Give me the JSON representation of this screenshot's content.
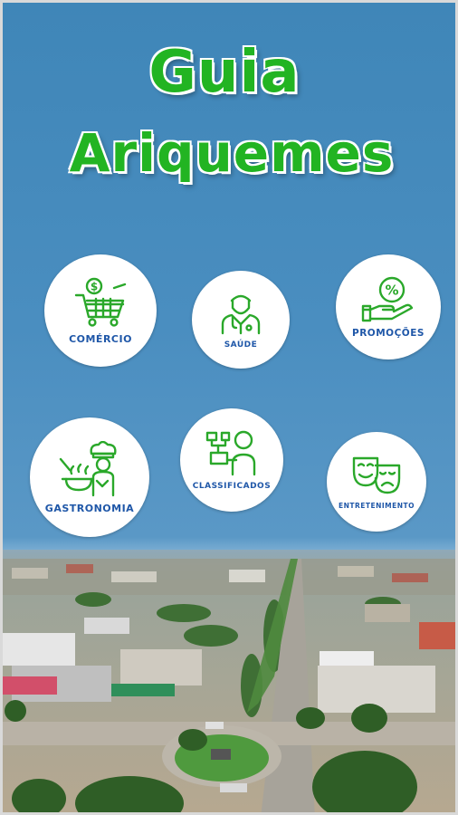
{
  "app": {
    "title_line1": "Guia",
    "title_line2": "Ariquemes"
  },
  "colors": {
    "brand_green": "#22b422",
    "label_blue": "#1f57a8",
    "sky_blue": "#4a8ec0"
  },
  "categories": [
    {
      "label": "COMÉRCIO",
      "icon": "shopping-cart-dollar-icon"
    },
    {
      "label": "SAÚDE",
      "icon": "doctor-icon"
    },
    {
      "label": "PROMOÇÕES",
      "icon": "hand-percent-icon"
    },
    {
      "label": "GASTRONOMIA",
      "icon": "chef-cooking-icon"
    },
    {
      "label": "CLASSIFICADOS",
      "icon": "person-flowchart-icon"
    },
    {
      "label": "ENTRETENIMENTO",
      "icon": "theater-masks-icon"
    }
  ]
}
